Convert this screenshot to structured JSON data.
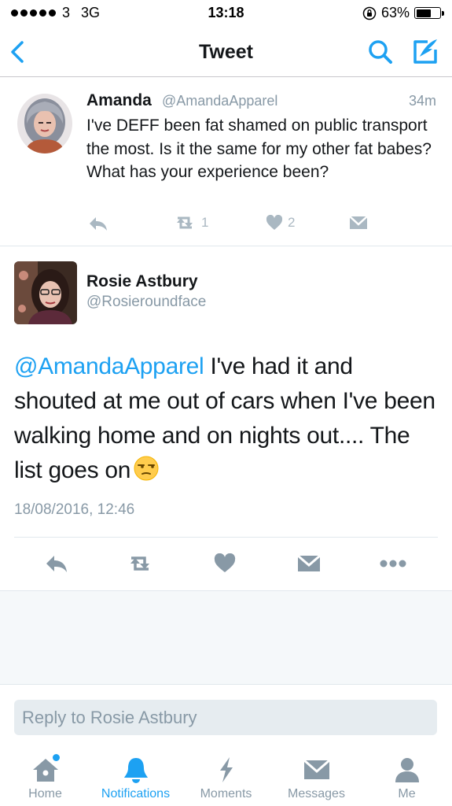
{
  "status_bar": {
    "carrier": "3",
    "network": "3G",
    "time": "13:18",
    "battery": "63%",
    "battery_level": 0.63
  },
  "nav": {
    "title": "Tweet",
    "back_icon": "chevron-left-icon",
    "search_icon": "search-icon",
    "compose_icon": "compose-icon"
  },
  "quoted_tweet": {
    "name": "Amanda",
    "handle": "@AmandaApparel",
    "time": "34m",
    "text": "I've DEFF been fat shamed on public transport the most. Is it the same for my other fat babes? What has your experience been?",
    "retweet_count": "1",
    "like_count": "2"
  },
  "main_tweet": {
    "name": "Rosie Astbury",
    "handle": "@Rosieroundface",
    "mention": "@AmandaApparel",
    "text": " I've had it and shouted at me out of cars when I've been walking home and on nights out.... The list goes on",
    "emoji": "unamused-face",
    "date": "18/08/2016, 12:46"
  },
  "reply": {
    "placeholder": "Reply to Rosie Astbury"
  },
  "tabs": [
    {
      "label": "Home",
      "icon": "home-icon"
    },
    {
      "label": "Notifications",
      "icon": "bell-icon"
    },
    {
      "label": "Moments",
      "icon": "lightning-icon"
    },
    {
      "label": "Messages",
      "icon": "envelope-icon"
    },
    {
      "label": "Me",
      "icon": "person-icon"
    }
  ],
  "colors": {
    "accent": "#1da1f2",
    "secondary_text": "#8899a6",
    "icon_gray": "#aab8c2",
    "action_gray": "#8899a6"
  }
}
